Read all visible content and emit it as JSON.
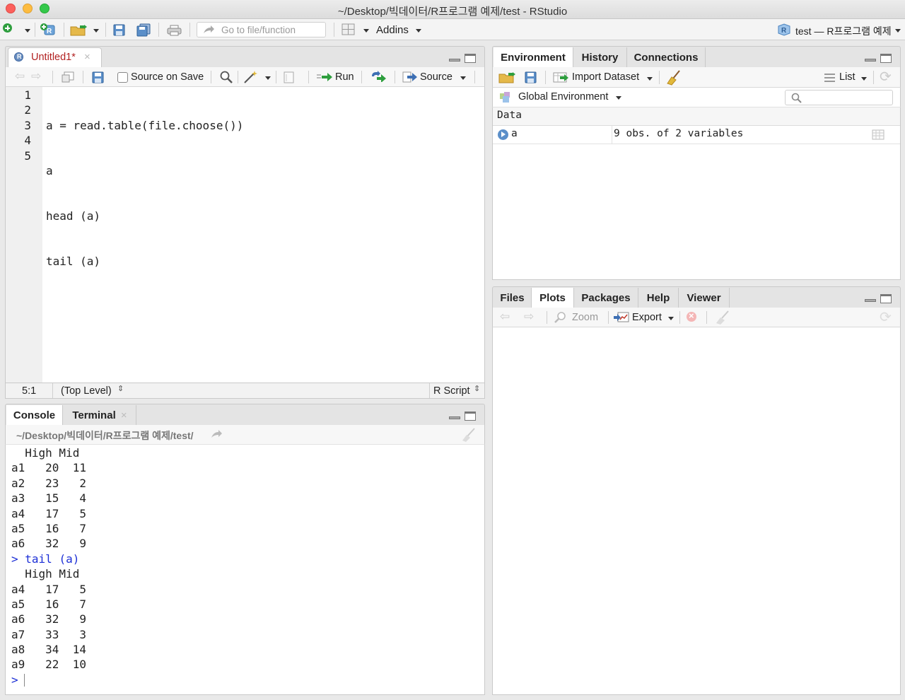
{
  "window": {
    "title": "~/Desktop/빅데이터/R프로그램 예제/test - RStudio"
  },
  "main_toolbar": {
    "goto_placeholder": "Go to file/function",
    "addins_label": "Addins",
    "project_label": "test — R프로그램 예제"
  },
  "source_pane": {
    "tab_label": "Untitled1*",
    "source_on_save_label": "Source on Save",
    "run_label": "Run",
    "source_label": "Source",
    "line_numbers": [
      "1",
      "2",
      "3",
      "4",
      "5"
    ],
    "code_lines": [
      "a = read.table(file.choose())",
      "a",
      "head (a)",
      "tail (a)",
      ""
    ],
    "status": {
      "cursor_pos": "5:1",
      "scope": "(Top Level)",
      "file_type": "R Script"
    }
  },
  "console_pane": {
    "tabs": [
      "Console",
      "Terminal"
    ],
    "path": "~/Desktop/빅데이터/R프로그램 예제/test/",
    "lines": [
      {
        "text": "  High Mid",
        "type": "out"
      },
      {
        "text": "a1   20  11",
        "type": "out"
      },
      {
        "text": "a2   23   2",
        "type": "out"
      },
      {
        "text": "a3   15   4",
        "type": "out"
      },
      {
        "text": "a4   17   5",
        "type": "out"
      },
      {
        "text": "a5   16   7",
        "type": "out"
      },
      {
        "text": "a6   32   9",
        "type": "out"
      },
      {
        "text": "tail (a)",
        "type": "cmd"
      },
      {
        "text": "  High Mid",
        "type": "out"
      },
      {
        "text": "a4   17   5",
        "type": "out"
      },
      {
        "text": "a5   16   7",
        "type": "out"
      },
      {
        "text": "a6   32   9",
        "type": "out"
      },
      {
        "text": "a7   33   3",
        "type": "out"
      },
      {
        "text": "a8   34  14",
        "type": "out"
      },
      {
        "text": "a9   22  10",
        "type": "out"
      }
    ],
    "prompt": ">"
  },
  "env_pane": {
    "tabs": [
      "Environment",
      "History",
      "Connections"
    ],
    "import_dataset_label": "Import Dataset",
    "list_label": "List",
    "global_env_label": "Global Environment",
    "section_label": "Data",
    "rows": [
      {
        "name": "a",
        "value": "9 obs. of 2 variables"
      }
    ]
  },
  "files_pane": {
    "tabs": [
      "Files",
      "Plots",
      "Packages",
      "Help",
      "Viewer"
    ],
    "zoom_label": "Zoom",
    "export_label": "Export"
  },
  "colors": {
    "prompt_blue": "#1c2fd6",
    "tab_red": "#b22222",
    "run_green": "#2e9e3e"
  }
}
